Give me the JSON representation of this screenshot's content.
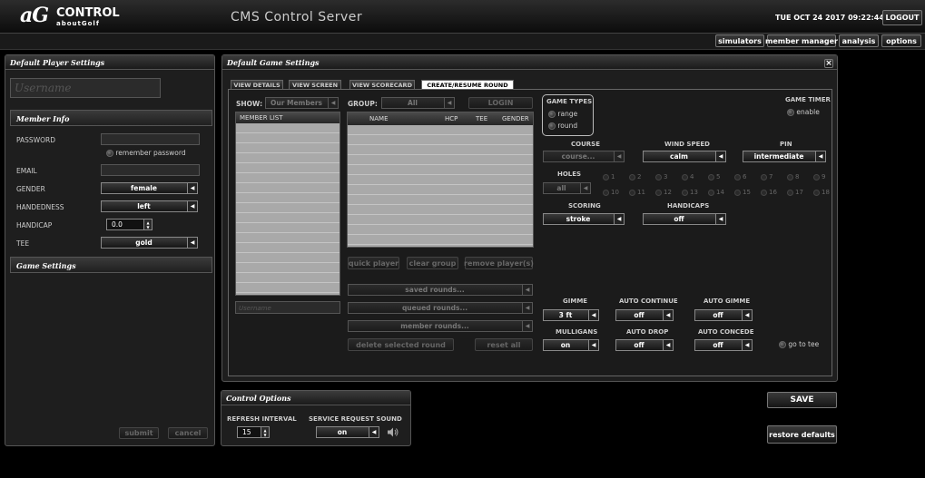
{
  "header": {
    "logo_big": "aG",
    "logo_control": "CONTROL",
    "logo_sub": "aboutGolf",
    "app_title": "CMS Control Server",
    "datetime": "TUE OCT 24 2017 09:22:44 AM",
    "logout": "LOGOUT"
  },
  "nav": {
    "simulators": "simulators",
    "member_manager": "member manager",
    "analysis": "analysis",
    "options": "options"
  },
  "player_panel": {
    "title": "Default Player Settings",
    "username_placeholder": "Username",
    "member_info": "Member Info",
    "password": "PASSWORD",
    "remember": "remember password",
    "email": "EMAIL",
    "gender": "GENDER",
    "gender_value": "female",
    "handedness": "HANDEDNESS",
    "handedness_value": "left",
    "handicap": "HANDICAP",
    "handicap_value": "0.0",
    "tee": "TEE",
    "tee_value": "gold",
    "game_settings": "Game Settings",
    "submit": "submit",
    "cancel": "cancel"
  },
  "game_panel": {
    "title": "Default Game Settings",
    "close": "×",
    "tabs": [
      "VIEW DETAILS",
      "VIEW SCREEN",
      "VIEW SCORECARD",
      "CREATE/RESUME ROUND"
    ],
    "show_label": "SHOW:",
    "show_value": "Our Members",
    "group_label": "GROUP:",
    "group_value": "All",
    "login": "LOGIN",
    "member_list": "MEMBER LIST",
    "cols": {
      "name": "NAME",
      "hcp": "HCP",
      "tee": "TEE",
      "gender": "GENDER"
    },
    "username_placeholder": "Username",
    "quick_player": "quick player",
    "clear_group": "clear group",
    "remove_players": "remove player(s)",
    "saved_rounds": "saved rounds...",
    "queued_rounds": "queued rounds...",
    "member_rounds": "member rounds...",
    "delete_round": "delete selected round",
    "reset_all": "reset all",
    "game_types": "GAME TYPES",
    "range": "range",
    "round": "round",
    "game_timer": "GAME TIMER",
    "enable": "enable",
    "course": "COURSE",
    "course_value": "course...",
    "wind_speed": "WIND SPEED",
    "wind_value": "calm",
    "pin": "PIN",
    "pin_value": "intermediate",
    "holes": "HOLES",
    "holes_value": "all",
    "holes_list": [
      "1",
      "2",
      "3",
      "4",
      "5",
      "6",
      "7",
      "8",
      "9",
      "10",
      "11",
      "12",
      "13",
      "14",
      "15",
      "16",
      "17",
      "18"
    ],
    "scoring": "SCORING",
    "scoring_value": "stroke",
    "handicaps": "HANDICAPS",
    "handicaps_value": "off",
    "gimme": "GIMME",
    "gimme_value": "3 ft",
    "auto_continue": "AUTO CONTINUE",
    "auto_continue_value": "off",
    "auto_gimme": "AUTO GIMME",
    "auto_gimme_value": "off",
    "mulligans": "MULLIGANS",
    "mulligans_value": "on",
    "auto_drop": "AUTO DROP",
    "auto_drop_value": "off",
    "auto_concede": "AUTO CONCEDE",
    "auto_concede_value": "off",
    "go_to_tee": "go to tee"
  },
  "control_panel": {
    "title": "Control Options",
    "refresh": "REFRESH INTERVAL",
    "refresh_value": "15",
    "sound": "SERVICE REQUEST SOUND",
    "sound_value": "on"
  },
  "actions": {
    "save": "SAVE",
    "restore": "restore defaults"
  }
}
